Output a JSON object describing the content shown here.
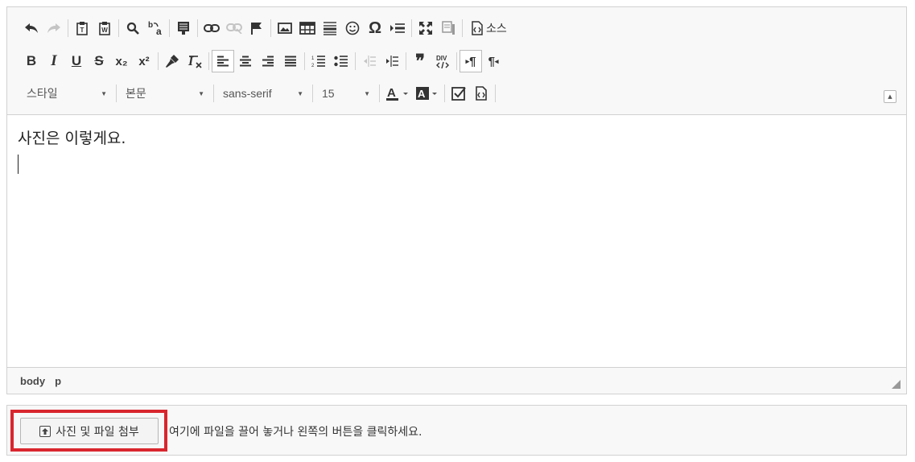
{
  "toolbar": {
    "source_label": "소스",
    "style_combo": "스타일",
    "format_combo": "본문",
    "font_combo": "sans-serif",
    "size_combo": "15",
    "bold": "B",
    "italic": "I",
    "underline": "U",
    "strike": "S",
    "subscript": "x₂",
    "superscript": "x²",
    "special_char": "Ω",
    "blockquote": "❞",
    "show_blocks": "¶",
    "rtl": "¶"
  },
  "content": {
    "text": "사진은 이렇게요."
  },
  "statusbar": {
    "path": [
      "body",
      "p"
    ]
  },
  "attach": {
    "button_label": "사진 및 파일 첨부",
    "hint": "여기에 파일을 끌어 놓거나 왼쪽의 버튼을 클릭하세요."
  },
  "colors": {
    "highlight_border": "#d9262e",
    "toolbar_bg": "#f8f8f8",
    "border": "#d1d1d1"
  }
}
